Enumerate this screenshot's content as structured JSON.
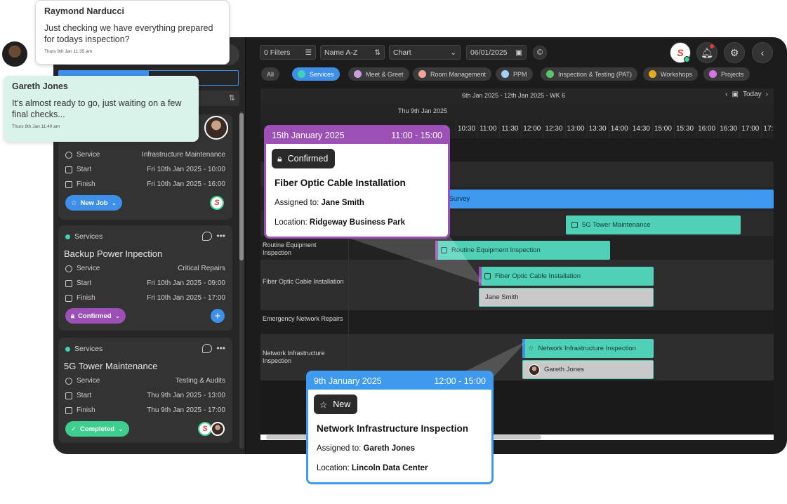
{
  "toolbar": {
    "filters_label": "0 Filters",
    "sort_label": "Name A-Z",
    "view_label": "Chart",
    "date_value": "06/01/2025"
  },
  "left_panel": {
    "segment_counter": "11",
    "cards": [
      {
        "category": "",
        "title": "",
        "service_label": "Service",
        "service_value": "Infrastructure Maintenance",
        "start_label": "Start",
        "start_value": "Fri 10th Jan 2025 - 10:00",
        "finish_label": "Finish",
        "finish_value": "Fri 10th Jan 2025 - 16:00",
        "status": "New Job"
      },
      {
        "category": "Services",
        "title": "Backup Power Inpection",
        "service_label": "Service",
        "service_value": "Critical Repairs",
        "start_label": "Start",
        "start_value": "Fri 10th Jan 2025 - 09:00",
        "finish_label": "Finish",
        "finish_value": "Fri 10th Jan 2025 - 17:00",
        "status": "Confirmed"
      },
      {
        "category": "Services",
        "title": "5G Tower Maintenance",
        "service_label": "Service",
        "service_value": "Testing & Audits",
        "start_label": "Start",
        "start_value": "Thu 9th Jan 2025 - 13:00",
        "finish_label": "Finish",
        "finish_value": "Thu 9th Jan 2025 - 17:00",
        "status": "Completed"
      }
    ]
  },
  "filters": [
    {
      "label": "All",
      "color": ""
    },
    {
      "label": "Services",
      "color": "#3fd3b5"
    },
    {
      "label": "Meet & Greet",
      "color": "#c9a0dc"
    },
    {
      "label": "Room Management",
      "color": "#f0a59a"
    },
    {
      "label": "PPM",
      "color": "#9fd2f5"
    },
    {
      "label": "Inspection & Testing (PAT)",
      "color": "#5cc46a"
    },
    {
      "label": "Workshops",
      "color": "#e8a81c"
    },
    {
      "label": "Projects",
      "color": "#d874e8"
    }
  ],
  "calendar": {
    "week_label": "6th Jan 2025 - 12th Jan 2025 - WK 6",
    "today_label": "Today",
    "day_label": "Thu 9th Jan 2025",
    "hours": [
      "10:30",
      "11:00",
      "11:30",
      "12:00",
      "12:30",
      "13:00",
      "13:30",
      "14:00",
      "14:30",
      "15:00",
      "15:30",
      "16:00",
      "16:30",
      "17:00",
      "17:"
    ],
    "rows": [
      {
        "label": "Routine Equipment Inspection"
      },
      {
        "label": "Fiber Optic Cable Installation"
      },
      {
        "label": "Emergency Network Repairs"
      },
      {
        "label": "Network Infrastructure Inspection"
      }
    ],
    "events": {
      "survey": "th Survey",
      "tower": "5G Tower Maintenance",
      "routine": "Routine Equipment Inspection",
      "fiber": "Fiber Optic Cable Installation",
      "fiber_assignee": "Jane Smith",
      "network": "Network Infrastructure Inspection",
      "network_assignee": "Gareth Jones"
    }
  },
  "popups": {
    "fiber": {
      "date": "15th January 2025",
      "time": "11:00 - 15:00",
      "status": "Confirmed",
      "title": "Fiber Optic Cable Installation",
      "assigned_label": "Assigned to:",
      "assigned_value": "Jane Smith",
      "location_label": "Location:",
      "location_value": "Ridgeway Business Park"
    },
    "network": {
      "date": "9th January 2025",
      "time": "12:00 - 15:00",
      "status": "New",
      "title": "Network Infrastructure Inspection",
      "assigned_label": "Assigned to:",
      "assigned_value": "Gareth Jones",
      "location_label": "Location:",
      "location_value": "Lincoln Data Center"
    }
  },
  "chats": [
    {
      "name": "Raymond Narducci",
      "message": "Just checking we have everything prepared for todays inspection?",
      "time": "Thurs 9th Jan 11:35 am"
    },
    {
      "name": "Gareth Jones",
      "message": "It's almost ready to go, just waiting on a few final checks...",
      "time": "Thurs 9th Jan 11:40 am"
    }
  ],
  "colors": {
    "accent": "#3d8fe8",
    "teal": "#4fd1b8",
    "purple": "#9c4fb5",
    "green": "#3ecf8e"
  }
}
